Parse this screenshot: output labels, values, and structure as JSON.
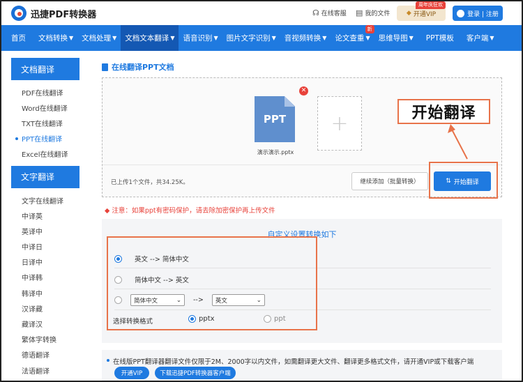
{
  "header": {
    "logo_text": "迅捷PDF转换器",
    "links": [
      {
        "icon": "headset-icon",
        "label": "在线客服"
      },
      {
        "icon": "document-icon",
        "label": "我的文件"
      }
    ],
    "vip_label": "开通VIP",
    "vip_tag": "周年庆狂欢",
    "login_label": "登录 | 注册"
  },
  "nav": {
    "items": [
      {
        "label": "首页",
        "dropdown": false
      },
      {
        "label": "文档转换",
        "dropdown": true
      },
      {
        "label": "文档处理",
        "dropdown": true
      },
      {
        "label": "文档文本翻译",
        "dropdown": true,
        "active": true
      },
      {
        "label": "语音识别",
        "dropdown": true
      },
      {
        "label": "图片文字识别",
        "dropdown": true
      },
      {
        "label": "音视频转换",
        "dropdown": true
      },
      {
        "label": "论文查重",
        "dropdown": true,
        "badge": "新"
      },
      {
        "label": "思维导图",
        "dropdown": true
      },
      {
        "label": "PPT模板",
        "dropdown": false
      },
      {
        "label": "客户端",
        "dropdown": true
      }
    ]
  },
  "sidebar": {
    "doc_head": "文档翻译",
    "doc_items": [
      "PDF在线翻译",
      "Word在线翻译",
      "TXT在线翻译",
      "PPT在线翻译",
      "Excel在线翻译"
    ],
    "text_head": "文字翻译",
    "text_items": [
      "文字在线翻译",
      "中译英",
      "英译中",
      "中译日",
      "日译中",
      "中译韩",
      "韩译中",
      "汉译藏",
      "藏译汉",
      "繁体字转换",
      "德语翻译",
      "法语翻译"
    ]
  },
  "main": {
    "title": "在线翻译PPT文档",
    "file_type": "PPT",
    "file_name": "演示演示.pptx",
    "add_plus": "+",
    "callout": "开始翻译",
    "status": "已上传1个文件，共34.25K。",
    "continue_label": "继续添加（批量转换）",
    "start_label": "开始翻译",
    "notice": "◆ 注意：如果ppt有密码保护，请去除加密保护再上传文件",
    "settings_title": "自定义设置转换如下",
    "option1": "英文 --> 简体中文",
    "option2": "简体中文 --> 英文",
    "from_select": "简体中文",
    "arrow_text": "-->",
    "to_select": "英文",
    "format_label": "选择转换格式",
    "format_pptx": "pptx",
    "format_ppt": "ppt",
    "info": "在线版PPT翻译器翻译文件仅限于2M、2000字以内文件，如需翻译更大文件、翻译更多格式文件，请开通VIP或下载客户端",
    "vip_pill": "开通VIP",
    "download_pill": "下载迅捷PDF转换器客户端"
  },
  "colors": {
    "brand": "#1f7ae0",
    "highlight": "#e8734a",
    "warning": "#e8423a"
  }
}
